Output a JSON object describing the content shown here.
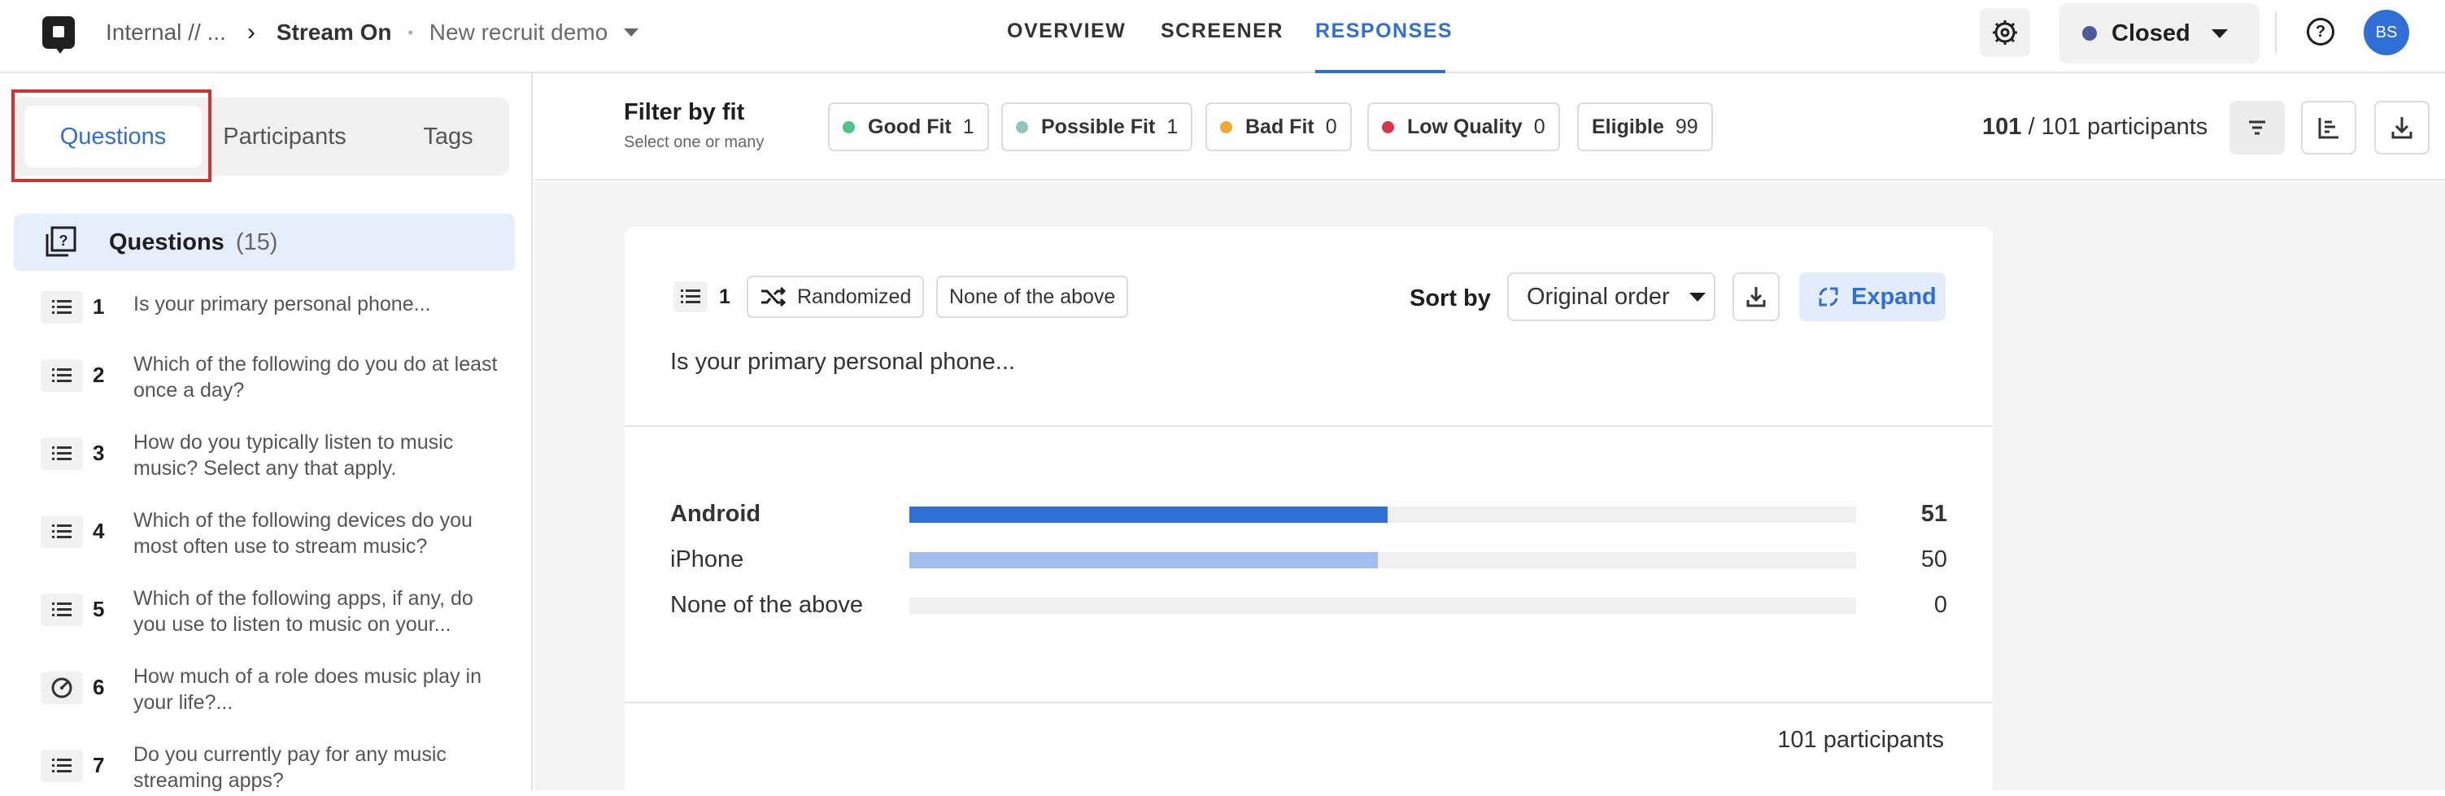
{
  "header": {
    "workspace": "Internal // ...",
    "study": "Stream On",
    "project": "New recruit demo",
    "tabs": [
      {
        "label": "OVERVIEW",
        "active": false
      },
      {
        "label": "SCREENER",
        "active": false
      },
      {
        "label": "RESPONSES",
        "active": true
      }
    ],
    "status": "Closed",
    "avatar_initials": "BS"
  },
  "sidebar": {
    "tabs": [
      "Questions",
      "Participants",
      "Tags"
    ],
    "active_tab": "Questions",
    "section_title": "Questions",
    "section_count": "(15)",
    "questions": [
      {
        "num": "1",
        "text": "Is your primary personal phone...",
        "icon": "list-icon"
      },
      {
        "num": "2",
        "text": "Which of the following do you do at least once a day?",
        "icon": "list-icon"
      },
      {
        "num": "3",
        "text": "How do you typically listen to music music? Select any that apply.",
        "icon": "list-icon"
      },
      {
        "num": "4",
        "text": "Which of the following devices do you most often use to stream music?",
        "icon": "list-icon"
      },
      {
        "num": "5",
        "text": "Which of the following apps, if any, do you use to listen to music on your...",
        "icon": "list-icon"
      },
      {
        "num": "6",
        "text": "How much of a role does music play in your life?...",
        "icon": "gauge-icon"
      },
      {
        "num": "7",
        "text": "Do you currently pay for any music streaming apps?",
        "icon": "list-icon"
      }
    ]
  },
  "filter": {
    "title": "Filter by fit",
    "subtitle": "Select one or many",
    "chips": [
      {
        "label": "Good Fit",
        "value": "1",
        "color": "#4cc38a"
      },
      {
        "label": "Possible Fit",
        "value": "1",
        "color": "#8fc7bf"
      },
      {
        "label": "Bad Fit",
        "value": "0",
        "color": "#f0a830"
      },
      {
        "label": "Low Quality",
        "value": "0",
        "color": "#d8344a"
      },
      {
        "label": "Eligible",
        "value": "99",
        "color": ""
      }
    ],
    "count_shown": "101",
    "count_total": "/ 101 participants"
  },
  "question_card": {
    "number": "1",
    "tags": [
      "Randomized",
      "None of the above"
    ],
    "sort_label": "Sort by",
    "sort_value": "Original order",
    "expand_label": "Expand",
    "question_text": "Is your primary personal phone...",
    "footer": "101 participants"
  },
  "chart_data": {
    "type": "bar",
    "orientation": "horizontal",
    "categories": [
      "Android",
      "iPhone",
      "None of the above"
    ],
    "values": [
      51,
      50,
      0
    ],
    "total": 101,
    "colors": [
      "#2f6fd6",
      "#a3bcf0",
      "#a3bcf0"
    ]
  }
}
